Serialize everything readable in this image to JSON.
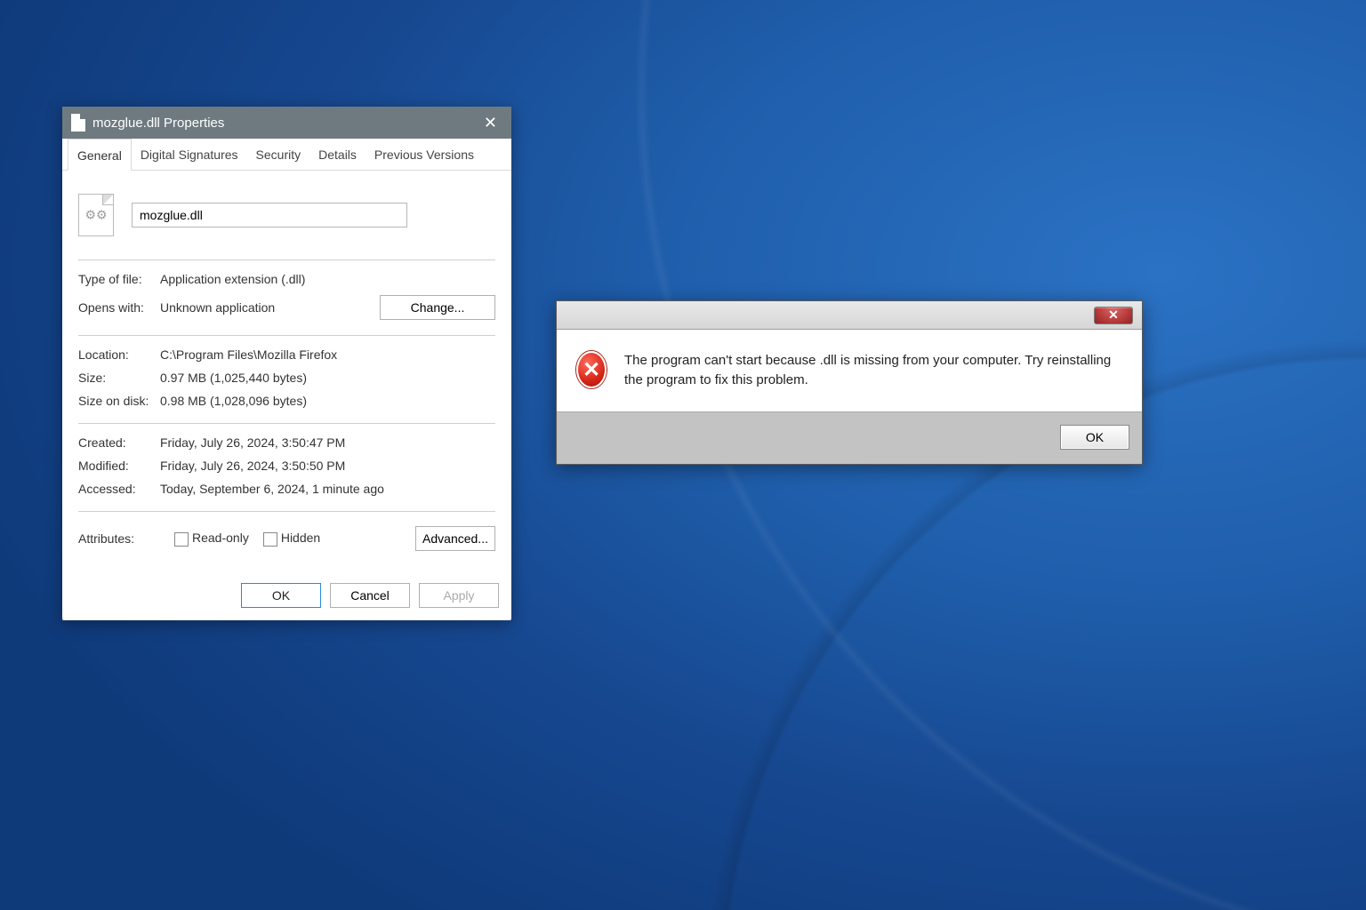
{
  "properties": {
    "window_title": "mozglue.dll Properties",
    "tabs": [
      "General",
      "Digital Signatures",
      "Security",
      "Details",
      "Previous Versions"
    ],
    "filename": "mozglue.dll",
    "labels": {
      "type_of_file": "Type of file:",
      "opens_with": "Opens with:",
      "location": "Location:",
      "size": "Size:",
      "size_on_disk": "Size on disk:",
      "created": "Created:",
      "modified": "Modified:",
      "accessed": "Accessed:",
      "attributes": "Attributes:"
    },
    "values": {
      "type_of_file": "Application extension (.dll)",
      "opens_with": "Unknown application",
      "location": "C:\\Program Files\\Mozilla Firefox",
      "size": "0.97 MB (1,025,440 bytes)",
      "size_on_disk": "0.98 MB (1,028,096 bytes)",
      "created": "Friday, July 26, 2024, 3:50:47 PM",
      "modified": "Friday, July 26, 2024, 3:50:50 PM",
      "accessed": "Today, September 6, 2024, 1 minute ago"
    },
    "buttons": {
      "change": "Change...",
      "advanced": "Advanced...",
      "ok": "OK",
      "cancel": "Cancel",
      "apply": "Apply"
    },
    "checkboxes": {
      "readonly": "Read-only",
      "hidden": "Hidden"
    }
  },
  "error": {
    "message": "The program can't start because           .dll is missing from your computer. Try reinstalling the program to fix this problem.",
    "ok": "OK"
  }
}
